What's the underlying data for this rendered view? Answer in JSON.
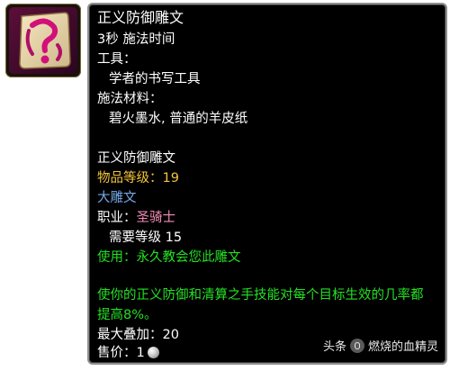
{
  "item": {
    "icon": "glyph-scroll-icon",
    "name": "正义防御雕文",
    "cast_time": "3秒 施法时间",
    "tools_label": "工具：",
    "tool": "学者的书写工具",
    "reagents_label": "施法材料：",
    "reagents": "碧火墨水, 普通的羊皮纸",
    "result_name": "正义防御雕文",
    "item_level_label": "物品等级：",
    "item_level": "19",
    "glyph_type": "大雕文",
    "class_label": "职业：",
    "class_name": "圣骑士",
    "required_level": "需要等级 15",
    "use_text": "使用：永久教会您此雕文",
    "effect_line1": "使你的正义防御和清算之手技能对每个目标生效的几率都",
    "effect_line2": "提高8%。",
    "max_stack": "最大叠加：20",
    "sell_price_label": "售价：",
    "sell_price_value": "1"
  },
  "watermark": {
    "brand": "头条",
    "author": "燃烧的血精灵"
  },
  "colors": {
    "gold": "#f2c53a",
    "blue": "#74a9e8",
    "pink": "#f38bb6",
    "green": "#24e024",
    "border": "#8f8f8f",
    "background": "#000000"
  }
}
